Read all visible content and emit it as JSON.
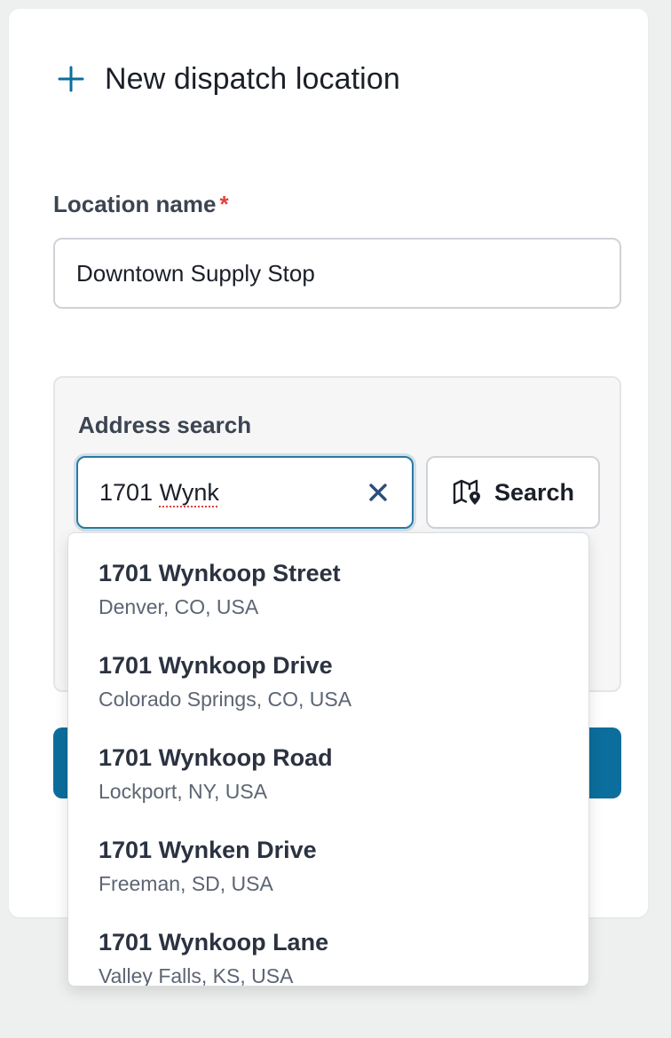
{
  "header": {
    "icon": "plus-icon",
    "title": "New dispatch location"
  },
  "form": {
    "location_name_label": "Location name",
    "required_mark": "*",
    "location_name_value": "Downtown Supply Stop"
  },
  "address_search": {
    "label": "Address search",
    "query": "1701 Wynk",
    "query_prefix": "1701 ",
    "query_misspelled": "Wynk",
    "clear_icon": "close-icon",
    "search_button_icon": "map-pin-icon",
    "search_button_label": "Search"
  },
  "primary_action": {
    "label": ""
  },
  "suggestions": [
    {
      "title": "1701 Wynkoop Street",
      "subtitle": "Denver, CO, USA"
    },
    {
      "title": "1701 Wynkoop Drive",
      "subtitle": "Colorado Springs, CO, USA"
    },
    {
      "title": "1701 Wynkoop Road",
      "subtitle": "Lockport, NY, USA"
    },
    {
      "title": "1701 Wynken Drive",
      "subtitle": "Freeman, SD, USA"
    },
    {
      "title": "1701 Wynkoop Lane",
      "subtitle": "Valley Falls, KS, USA"
    }
  ],
  "colors": {
    "accent": "#0c6e9c",
    "required": "#e0423b",
    "focus_border": "#2a7aa3",
    "background": "#eef0ef"
  }
}
